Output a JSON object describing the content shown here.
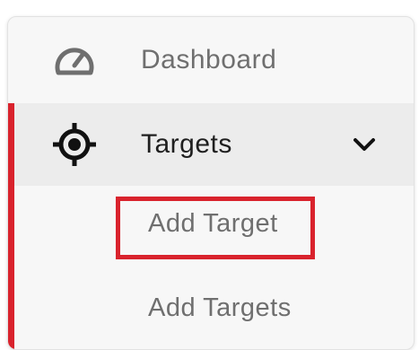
{
  "sidebar": {
    "items": [
      {
        "label": "Dashboard",
        "icon": "gauge-icon"
      },
      {
        "label": "Targets",
        "icon": "crosshair-icon",
        "expanded": true,
        "chevron": "chevron-down-icon"
      }
    ],
    "subitems": [
      {
        "label": "Add Target",
        "highlighted": true
      },
      {
        "label": "Add Targets"
      }
    ]
  },
  "colors": {
    "accent": "#d9232d",
    "muted_text": "#6f6f6f",
    "dark_text": "#1f1f1f",
    "active_bg": "#ececec",
    "panel_bg": "#f7f7f7"
  }
}
